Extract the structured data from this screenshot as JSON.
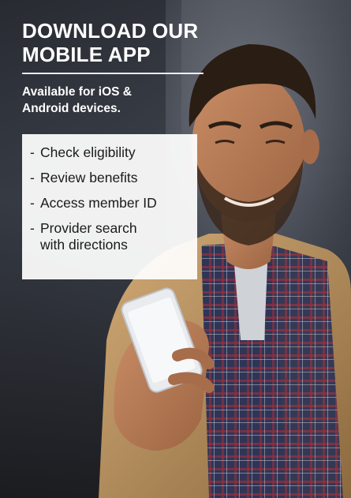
{
  "promo": {
    "headline_line1": "DOWNLOAD OUR",
    "headline_line2": "MOBILE APP",
    "sub_line1": "Available for iOS &",
    "sub_line2": "Android devices.",
    "features": [
      {
        "line1": "Check eligibility"
      },
      {
        "line1": "Review benefits"
      },
      {
        "line1": "Access member ID"
      },
      {
        "line1": "Provider search",
        "line2": "with directions"
      }
    ],
    "bullet_symbol": "-"
  },
  "photo": {
    "icon": "man-using-smartphone-photo",
    "colors": {
      "jacket": "#b98f5c",
      "shirt": "#2e3556",
      "skin": "#b57a55",
      "hair": "#2a1d14",
      "phone": "#e9ebee"
    }
  }
}
